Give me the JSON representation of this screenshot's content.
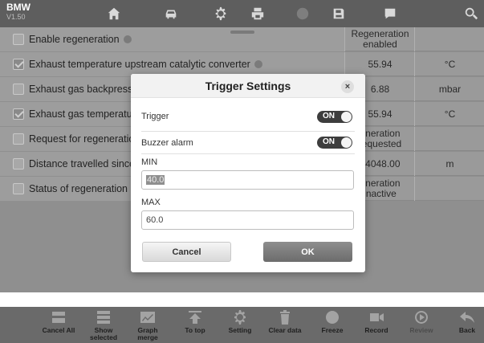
{
  "app": {
    "title": "BMW",
    "version": "V1.50"
  },
  "topbar": {
    "icons": [
      "home-icon",
      "vehicle-icon",
      "settings-icon",
      "print-icon",
      "help-icon",
      "save-icon",
      "message-icon",
      "search-icon"
    ]
  },
  "rows": [
    {
      "label": "Enable regeneration",
      "checked": false,
      "info": true,
      "value": "Regeneration enabled",
      "unit": ""
    },
    {
      "label": "Exhaust temperature upstream catalytic converter",
      "checked": true,
      "info": true,
      "value": "55.94",
      "unit": "°C"
    },
    {
      "label": "Exhaust gas backpress",
      "checked": false,
      "info": false,
      "value": "6.88",
      "unit": "mbar"
    },
    {
      "label": "Exhaust gas temperatu",
      "checked": true,
      "info": false,
      "value": "55.94",
      "unit": "°C"
    },
    {
      "label": "Request for regeneratio",
      "checked": false,
      "info": false,
      "value": "eneration requested",
      "unit": ""
    },
    {
      "label": "Distance travelled since",
      "checked": false,
      "info": false,
      "value": "34048.00",
      "unit": "m"
    },
    {
      "label": "Status of regeneration",
      "checked": false,
      "info": false,
      "value": "eneration inactive",
      "unit": ""
    }
  ],
  "dialog": {
    "title": "Trigger Settings",
    "close": "×",
    "trigger_label": "Trigger",
    "trigger_state": "ON",
    "buzzer_label": "Buzzer alarm",
    "buzzer_state": "ON",
    "min_label": "MIN",
    "min_value": "40.0",
    "max_label": "MAX",
    "max_value": "60.0",
    "cancel_label": "Cancel",
    "ok_label": "OK"
  },
  "toolbar": {
    "items": [
      {
        "label": "Cancel All",
        "icon": "cancel-all-icon"
      },
      {
        "label": "Show selected",
        "icon": "show-selected-icon"
      },
      {
        "label": "Graph merge",
        "icon": "graph-merge-icon"
      },
      {
        "label": "To top",
        "icon": "to-top-icon"
      },
      {
        "label": "Setting",
        "icon": "setting-icon"
      },
      {
        "label": "Clear data",
        "icon": "trash-icon"
      },
      {
        "label": "Freeze",
        "icon": "freeze-icon"
      },
      {
        "label": "Record",
        "icon": "record-icon"
      },
      {
        "label": "Review",
        "icon": "review-icon"
      },
      {
        "label": "Back",
        "icon": "back-icon"
      }
    ]
  }
}
